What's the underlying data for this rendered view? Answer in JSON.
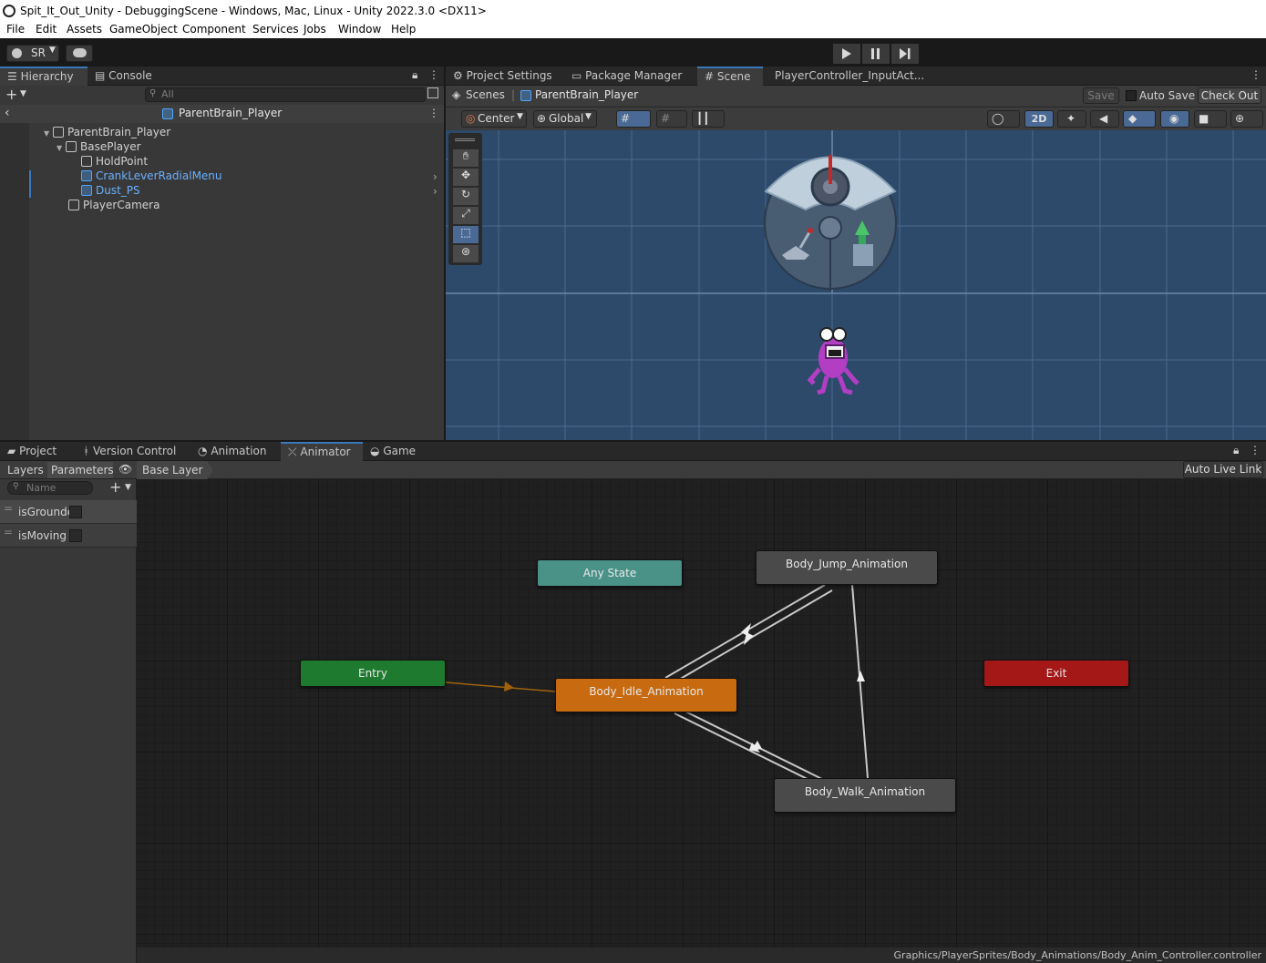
{
  "window": {
    "title": "Spit_It_Out_Unity - DebuggingScene - Windows, Mac, Linux - Unity 2022.3.0 <DX11>"
  },
  "menu": [
    "File",
    "Edit",
    "Assets",
    "GameObject",
    "Component",
    "Services",
    "Jobs",
    "Window",
    "Help"
  ],
  "toolbar": {
    "account": "SR"
  },
  "hierarchy": {
    "tabs": [
      "Hierarchy",
      "Console"
    ],
    "search_placeholder": "All",
    "prefab_title": "ParentBrain_Player",
    "rows": [
      "ParentBrain_Player",
      "BasePlayer",
      "HoldPoint",
      "CrankLeverRadialMenu",
      "Dust_PS",
      "PlayerCamera"
    ]
  },
  "scene": {
    "tabs": [
      "Project Settings",
      "Package Manager",
      "Scene",
      "PlayerController_InputAct..."
    ],
    "breadcrumb_root": "Scenes",
    "breadcrumb_prefab": "ParentBrain_Player",
    "save": "Save",
    "auto_save": "Auto Save",
    "check_out": "Check Out",
    "pivot": "Center",
    "space": "Global",
    "mode_2d": "2D"
  },
  "bottom": {
    "tabs": [
      "Project",
      "Version Control",
      "Animation",
      "Animator",
      "Game"
    ],
    "layers": "Layers",
    "parameters": "Parameters",
    "base_layer": "Base Layer",
    "auto_live_link": "Auto Live Link",
    "name_placeholder": "Name",
    "params": [
      {
        "name": "isGrounde",
        "value": false
      },
      {
        "name": "isMoving",
        "value": false
      }
    ],
    "states": {
      "any": "Any State",
      "jump": "Body_Jump_Animation",
      "entry": "Entry",
      "idle": "Body_Idle_Animation",
      "exit": "Exit",
      "walk": "Body_Walk_Animation"
    },
    "path": "Graphics/PlayerSprites/Body_Animations/Body_Anim_Controller.controller"
  },
  "colors": {
    "entry": "#1e7a2e",
    "any_state": "#4a9188",
    "idle": "#c86a10",
    "exit": "#a51818",
    "state": "#4a4a4a",
    "accent": "#3a79bb"
  }
}
